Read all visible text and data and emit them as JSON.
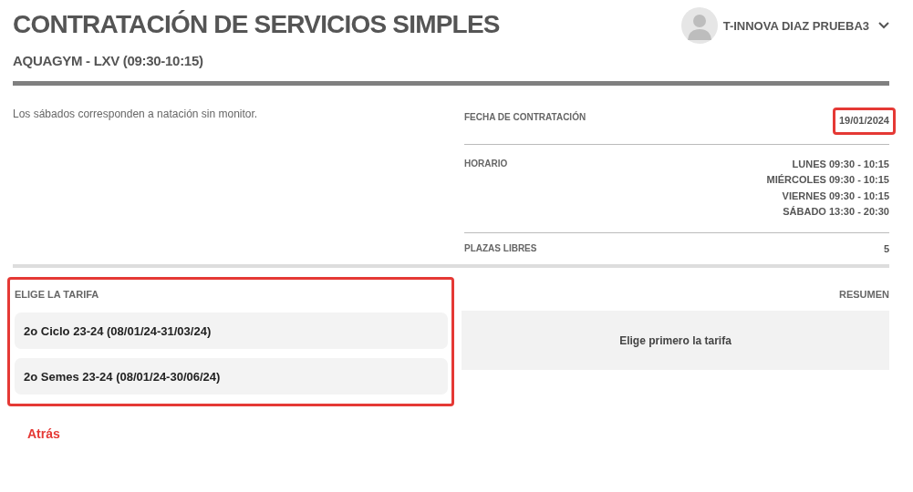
{
  "header": {
    "title": "CONTRATACIÓN DE SERVICIOS SIMPLES",
    "subtitle": "AQUAGYM - LXV (09:30-10:15)",
    "user": {
      "name": "T-INNOVA DIAZ PRUEBA3"
    }
  },
  "note": "Los sábados corresponden a natación sin monitor.",
  "details": [
    {
      "label": "FECHA DE CONTRATACIÓN",
      "values": [
        "19/01/2024"
      ],
      "highlighted": true
    },
    {
      "label": "HORARIO",
      "values": [
        "LUNES 09:30 - 10:15",
        "MIÉRCOLES 09:30 - 10:15",
        "VIERNES 09:30 - 10:15",
        "SÁBADO 13:30 - 20:30"
      ],
      "highlighted": false
    },
    {
      "label": "PLAZAS LIBRES",
      "values": [
        "5"
      ],
      "highlighted": false
    }
  ],
  "tariffs": {
    "title": "ELIGE LA TARIFA",
    "highlighted": true,
    "options": [
      {
        "label": "2o Ciclo 23-24 (08/01/24-31/03/24)",
        "selected": false
      },
      {
        "label": "2o Semes 23-24 (08/01/24-30/06/24)",
        "selected": false
      }
    ]
  },
  "summary": {
    "title": "RESUMEN",
    "message": "Elige primero la tarifa"
  },
  "back_link": "Atrás"
}
